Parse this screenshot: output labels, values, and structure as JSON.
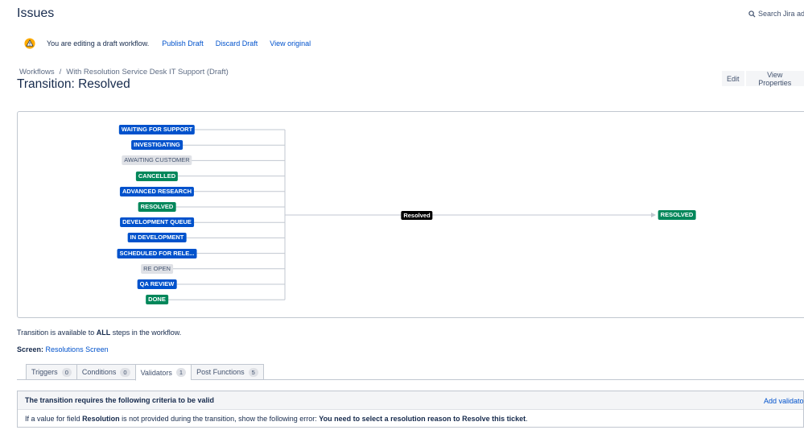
{
  "header": {
    "title": "Issues",
    "search_label": "Search Jira adm"
  },
  "draft_bar": {
    "message": "You are editing a draft workflow.",
    "publish_label": "Publish Draft",
    "discard_label": "Discard Draft",
    "view_original_label": "View original"
  },
  "breadcrumb": {
    "workflows": "Workflows",
    "separator": "/",
    "current": "With Resolution Service Desk IT Support (Draft)"
  },
  "page_title": "Transition: Resolved",
  "actions": {
    "edit_label": "Edit",
    "view_properties_label": "View Properties"
  },
  "diagram": {
    "source_statuses": [
      {
        "label": "WAITING FOR SUPPORT",
        "category": "blue"
      },
      {
        "label": "INVESTIGATING",
        "category": "blue"
      },
      {
        "label": "AWAITING CUSTOMER",
        "category": "grey"
      },
      {
        "label": "CANCELLED",
        "category": "green"
      },
      {
        "label": "ADVANCED RESEARCH",
        "category": "blue"
      },
      {
        "label": "RESOLVED",
        "category": "green"
      },
      {
        "label": "DEVELOPMENT QUEUE",
        "category": "blue"
      },
      {
        "label": "IN DEVELOPMENT",
        "category": "blue"
      },
      {
        "label": "SCHEDULED FOR RELE...",
        "category": "blue"
      },
      {
        "label": "RE OPEN",
        "category": "grey"
      },
      {
        "label": "QA REVIEW",
        "category": "blue"
      },
      {
        "label": "DONE",
        "category": "green"
      }
    ],
    "transition_label": "Resolved",
    "target_status": {
      "label": "RESOLVED",
      "category": "green"
    },
    "colors": {
      "blue": "#0052cc",
      "green": "#00875a",
      "grey": "#dfe1e6"
    }
  },
  "availability": {
    "prefix": "Transition is available to",
    "emphasis": "ALL",
    "suffix": "steps in the workflow."
  },
  "screen": {
    "label": "Screen",
    "value": "Resolutions Screen"
  },
  "tabs": [
    {
      "label": "Triggers",
      "count": "0",
      "active": false
    },
    {
      "label": "Conditions",
      "count": "0",
      "active": false
    },
    {
      "label": "Validators",
      "count": "1",
      "active": true
    },
    {
      "label": "Post Functions",
      "count": "5",
      "active": false
    }
  ],
  "validator": {
    "heading": "The transition requires the following criteria to be valid",
    "add_label": "Add validator",
    "text_1": "If a value for field",
    "field": "Resolution",
    "text_2": "is not provided during the transition, show the following error:",
    "error": "You need to select a resolution reason to Resolve this ticket",
    "text_3": "."
  }
}
